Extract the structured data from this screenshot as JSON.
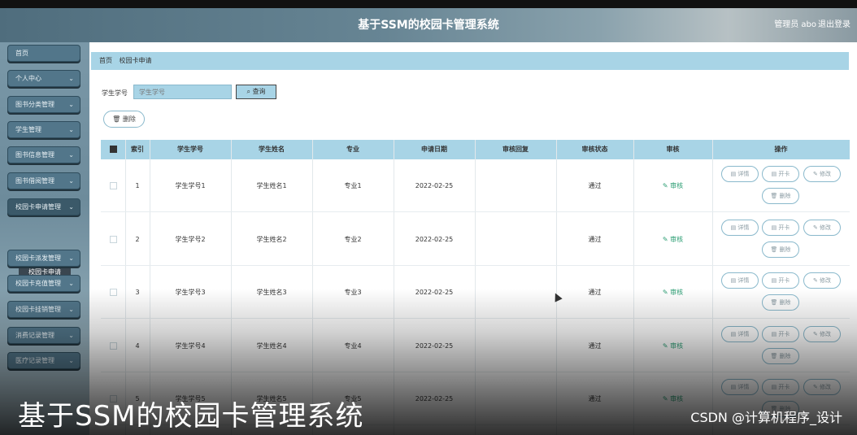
{
  "header": {
    "title": "基于SSM的校园卡管理系统",
    "user": "管理员 abo",
    "logout": "退出登录"
  },
  "sidebar": {
    "items": [
      {
        "label": "首页",
        "chevron": false
      },
      {
        "label": "个人中心",
        "chevron": true
      },
      {
        "label": "图书分类管理",
        "chevron": true
      },
      {
        "label": "学生管理",
        "chevron": true
      },
      {
        "label": "图书信息管理",
        "chevron": true
      },
      {
        "label": "图书借阅管理",
        "chevron": true
      },
      {
        "label": "校园卡申请管理",
        "chevron": true
      },
      {
        "label": "校园卡派发管理",
        "chevron": true
      },
      {
        "label": "校园卡充值管理",
        "chevron": true
      },
      {
        "label": "校园卡挂销管理",
        "chevron": true
      },
      {
        "label": "消费记录管理",
        "chevron": true
      },
      {
        "label": "医疗记录管理",
        "chevron": true
      }
    ],
    "sub_item": "校园卡申请"
  },
  "breadcrumb": [
    "首页",
    "校园卡申请"
  ],
  "search": {
    "label": "学生学号",
    "placeholder": "学生学号",
    "button": "查询"
  },
  "delete_button": "删除",
  "table": {
    "columns": [
      "索引",
      "学生学号",
      "学生姓名",
      "专业",
      "申请日期",
      "审核回复",
      "审核状态",
      "审核",
      "操作"
    ],
    "rows": [
      {
        "index": "1",
        "student_id": "学生学号1",
        "name": "学生姓名1",
        "major": "专业1",
        "date": "2022-02-25",
        "reply": "",
        "status": "通过",
        "audit": "审核"
      },
      {
        "index": "2",
        "student_id": "学生学号2",
        "name": "学生姓名2",
        "major": "专业2",
        "date": "2022-02-25",
        "reply": "",
        "status": "通过",
        "audit": "审核"
      },
      {
        "index": "3",
        "student_id": "学生学号3",
        "name": "学生姓名3",
        "major": "专业3",
        "date": "2022-02-25",
        "reply": "",
        "status": "通过",
        "audit": "审核"
      },
      {
        "index": "4",
        "student_id": "学生学号4",
        "name": "学生姓名4",
        "major": "专业4",
        "date": "2022-02-25",
        "reply": "",
        "status": "通过",
        "audit": "审核"
      },
      {
        "index": "5",
        "student_id": "学生学号5",
        "name": "学生姓名5",
        "major": "专业5",
        "date": "2022-02-25",
        "reply": "",
        "status": "通过",
        "audit": "审核"
      }
    ],
    "actions": [
      "详情",
      "开卡",
      "修改",
      "删除"
    ]
  },
  "overlay": {
    "caption": "基于SSM的校园卡管理系统",
    "credit": "CSDN @计算机程序_设计"
  }
}
